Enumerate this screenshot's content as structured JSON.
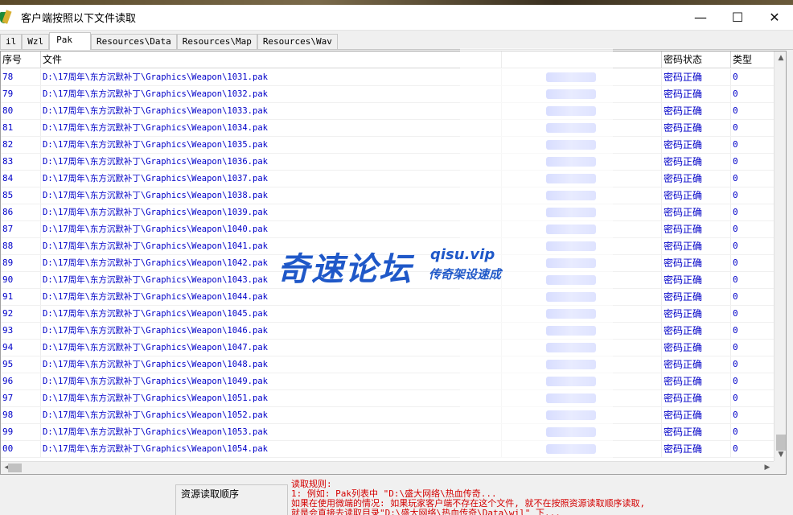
{
  "window": {
    "title": "客户端按照以下文件读取",
    "minimize_glyph": "—",
    "maximize_glyph": "☐",
    "close_glyph": "✕"
  },
  "tabs": [
    {
      "label": "il"
    },
    {
      "label": "Wzl"
    },
    {
      "label": "Pak",
      "active": true
    },
    {
      "label": "Resources\\Data"
    },
    {
      "label": "Resources\\Map"
    },
    {
      "label": "Resources\\Wav"
    }
  ],
  "list": {
    "headers": {
      "no": "序号",
      "file": "文件",
      "pw_status": "密码状态",
      "type": "类型"
    },
    "rows": [
      {
        "no": "78",
        "file": "D:\\17周年\\东方沉默补丁\\Graphics\\Weapon\\1031.pak",
        "status": "密码正确",
        "type": "0"
      },
      {
        "no": "79",
        "file": "D:\\17周年\\东方沉默补丁\\Graphics\\Weapon\\1032.pak",
        "status": "密码正确",
        "type": "0"
      },
      {
        "no": "80",
        "file": "D:\\17周年\\东方沉默补丁\\Graphics\\Weapon\\1033.pak",
        "status": "密码正确",
        "type": "0"
      },
      {
        "no": "81",
        "file": "D:\\17周年\\东方沉默补丁\\Graphics\\Weapon\\1034.pak",
        "status": "密码正确",
        "type": "0"
      },
      {
        "no": "82",
        "file": "D:\\17周年\\东方沉默补丁\\Graphics\\Weapon\\1035.pak",
        "status": "密码正确",
        "type": "0"
      },
      {
        "no": "83",
        "file": "D:\\17周年\\东方沉默补丁\\Graphics\\Weapon\\1036.pak",
        "status": "密码正确",
        "type": "0"
      },
      {
        "no": "84",
        "file": "D:\\17周年\\东方沉默补丁\\Graphics\\Weapon\\1037.pak",
        "status": "密码正确",
        "type": "0"
      },
      {
        "no": "85",
        "file": "D:\\17周年\\东方沉默补丁\\Graphics\\Weapon\\1038.pak",
        "status": "密码正确",
        "type": "0"
      },
      {
        "no": "86",
        "file": "D:\\17周年\\东方沉默补丁\\Graphics\\Weapon\\1039.pak",
        "status": "密码正确",
        "type": "0"
      },
      {
        "no": "87",
        "file": "D:\\17周年\\东方沉默补丁\\Graphics\\Weapon\\1040.pak",
        "status": "密码正确",
        "type": "0"
      },
      {
        "no": "88",
        "file": "D:\\17周年\\东方沉默补丁\\Graphics\\Weapon\\1041.pak",
        "status": "密码正确",
        "type": "0"
      },
      {
        "no": "89",
        "file": "D:\\17周年\\东方沉默补丁\\Graphics\\Weapon\\1042.pak",
        "status": "密码正确",
        "type": "0"
      },
      {
        "no": "90",
        "file": "D:\\17周年\\东方沉默补丁\\Graphics\\Weapon\\1043.pak",
        "status": "密码正确",
        "type": "0"
      },
      {
        "no": "91",
        "file": "D:\\17周年\\东方沉默补丁\\Graphics\\Weapon\\1044.pak",
        "status": "密码正确",
        "type": "0"
      },
      {
        "no": "92",
        "file": "D:\\17周年\\东方沉默补丁\\Graphics\\Weapon\\1045.pak",
        "status": "密码正确",
        "type": "0"
      },
      {
        "no": "93",
        "file": "D:\\17周年\\东方沉默补丁\\Graphics\\Weapon\\1046.pak",
        "status": "密码正确",
        "type": "0"
      },
      {
        "no": "94",
        "file": "D:\\17周年\\东方沉默补丁\\Graphics\\Weapon\\1047.pak",
        "status": "密码正确",
        "type": "0"
      },
      {
        "no": "95",
        "file": "D:\\17周年\\东方沉默补丁\\Graphics\\Weapon\\1048.pak",
        "status": "密码正确",
        "type": "0"
      },
      {
        "no": "96",
        "file": "D:\\17周年\\东方沉默补丁\\Graphics\\Weapon\\1049.pak",
        "status": "密码正确",
        "type": "0"
      },
      {
        "no": "97",
        "file": "D:\\17周年\\东方沉默补丁\\Graphics\\Weapon\\1051.pak",
        "status": "密码正确",
        "type": "0"
      },
      {
        "no": "98",
        "file": "D:\\17周年\\东方沉默补丁\\Graphics\\Weapon\\1052.pak",
        "status": "密码正确",
        "type": "0"
      },
      {
        "no": "99",
        "file": "D:\\17周年\\东方沉默补丁\\Graphics\\Weapon\\1053.pak",
        "status": "密码正确",
        "type": "0"
      },
      {
        "no": "00",
        "file": "D:\\17周年\\东方沉默补丁\\Graphics\\Weapon\\1054.pak",
        "status": "密码正确",
        "type": "0"
      }
    ]
  },
  "watermark": {
    "main": "奇速论坛",
    "url": "qisu.vip",
    "sub": "传奇架设速成"
  },
  "bottom": {
    "order_label": "资源读取顺序",
    "rules": [
      "读取规则:",
      "1: 例如: Pak列表中 \"D:\\盛大网络\\热血传奇...",
      "   如果在使用微端的情况: 如果玩家客户端不存在这个文件, 就不在按照资源读取顺序读取,",
      "   就是会直接去读取目录\"D:\\盛大网络\\热血传奇\\Data\\wil\" 下..."
    ]
  },
  "colors": {
    "list_text": "#0000c8",
    "rules_text": "#d40000",
    "watermark": "#1f58c8"
  }
}
